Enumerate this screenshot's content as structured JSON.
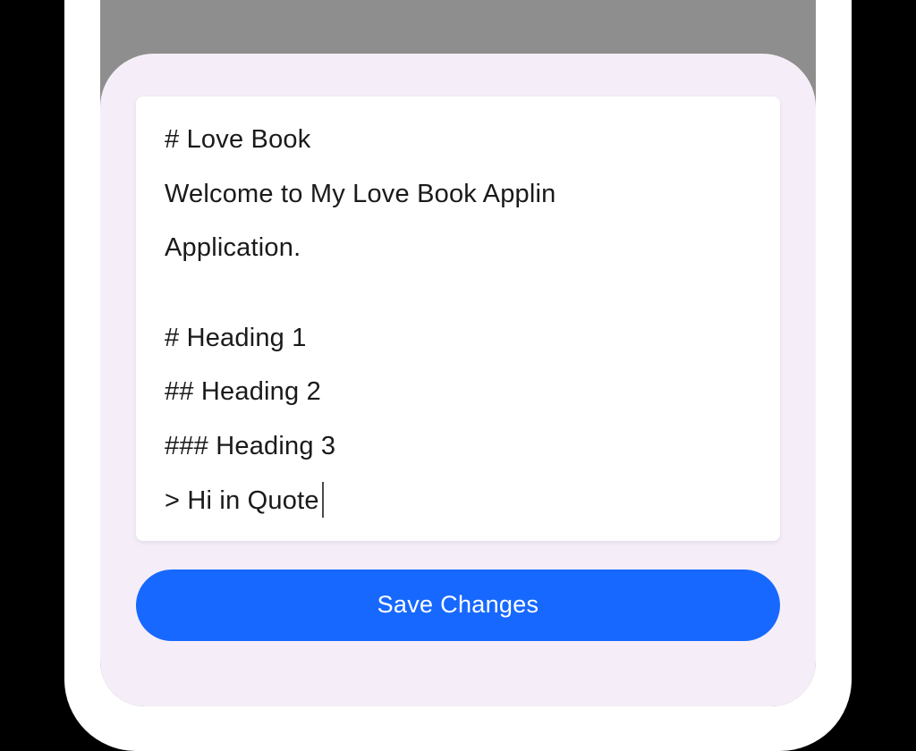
{
  "editor": {
    "lines": [
      "# Love Book",
      "Welcome to My Love Book Applin",
      "Application.",
      "",
      "# Heading 1",
      "## Heading 2",
      "### Heading 3",
      "> Hi in Quote"
    ]
  },
  "controls": {
    "save_label": "Save Changes"
  },
  "colors": {
    "accent": "#1768ff",
    "panel_bg": "#f5eef8",
    "screen_bg": "#8e8e8e"
  }
}
